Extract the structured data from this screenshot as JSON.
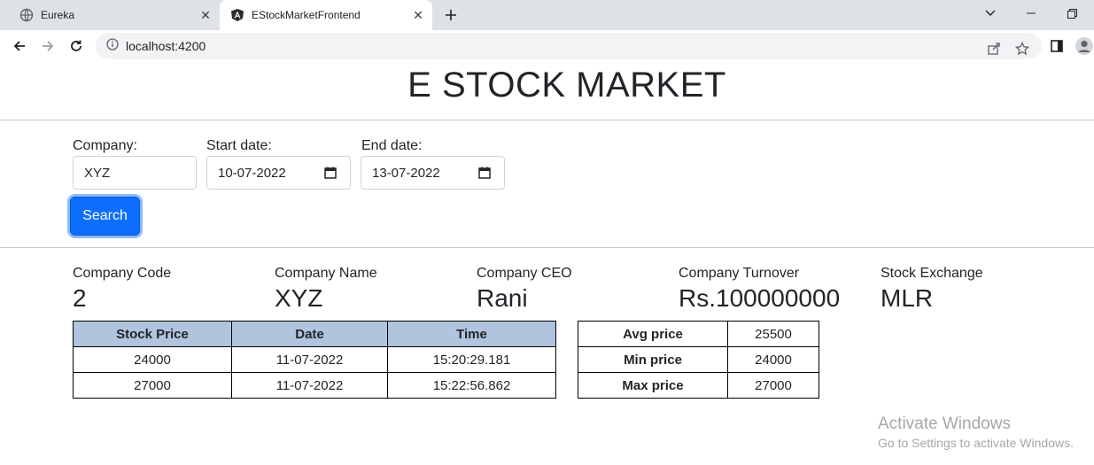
{
  "browser": {
    "tabs": [
      {
        "title": "Eureka",
        "icon": "globe-icon"
      },
      {
        "title": "EStockMarketFrontend",
        "icon": "angular-icon"
      }
    ],
    "url": "localhost:4200"
  },
  "page": {
    "title": "E STOCK MARKET",
    "form": {
      "company_label": "Company:",
      "company_value": "XYZ",
      "start_label": "Start date:",
      "start_value": "10-07-2022",
      "end_label": "End date:",
      "end_value": "13-07-2022",
      "search_label": "Search"
    },
    "company_info": [
      {
        "label": "Company Code",
        "value": "2"
      },
      {
        "label": "Company Name",
        "value": "XYZ"
      },
      {
        "label": "Company CEO",
        "value": "Rani"
      },
      {
        "label": "Company Turnover",
        "value": "Rs.100000000"
      },
      {
        "label": "Stock Exchange",
        "value": "MLR"
      }
    ],
    "price_table": {
      "headers": [
        "Stock Price",
        "Date",
        "Time"
      ],
      "rows": [
        [
          "24000",
          "11-07-2022",
          "15:20:29.181"
        ],
        [
          "27000",
          "11-07-2022",
          "15:22:56.862"
        ]
      ]
    },
    "stats_table": [
      {
        "label": "Avg price",
        "value": "25500"
      },
      {
        "label": "Min price",
        "value": "24000"
      },
      {
        "label": "Max price",
        "value": "27000"
      }
    ]
  },
  "watermark": {
    "line1": "Activate Windows",
    "line2": "Go to Settings to activate Windows."
  },
  "colors": {
    "primary_button": "#0d6efd",
    "table_header": "#b0c4de"
  }
}
